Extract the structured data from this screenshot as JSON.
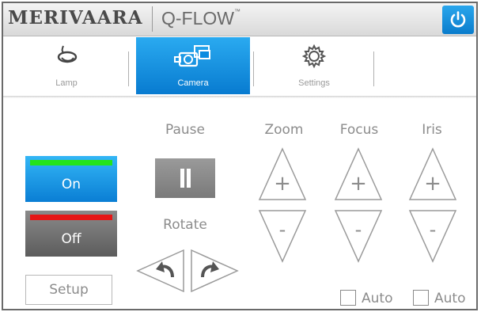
{
  "header": {
    "brand": "MERIVAARA",
    "product": "Q-FLOW",
    "trademark": "™",
    "power_icon": "power-icon",
    "accent": "#0a8ee0"
  },
  "tabs": [
    {
      "label": "Lamp",
      "icon": "lamp-icon",
      "active": false
    },
    {
      "label": "Camera",
      "icon": "camera-icon",
      "active": true
    },
    {
      "label": "Settings",
      "icon": "gear-icon",
      "active": false
    }
  ],
  "camera_panel": {
    "power": {
      "on_label": "On",
      "off_label": "Off",
      "on_indicator": "#24e31c",
      "off_indicator": "#e61616"
    },
    "setup_label": "Setup",
    "pause": {
      "label": "Pause",
      "icon": "pause-icon"
    },
    "rotate": {
      "label": "Rotate",
      "left_icon": "rotate-left-icon",
      "right_icon": "rotate-right-icon"
    },
    "zoom": {
      "label": "Zoom",
      "plus": "+",
      "minus": "-"
    },
    "focus": {
      "label": "Focus",
      "plus": "+",
      "minus": "-",
      "auto_label": "Auto",
      "auto_checked": false
    },
    "iris": {
      "label": "Iris",
      "plus": "+",
      "minus": "-",
      "auto_label": "Auto",
      "auto_checked": false
    }
  }
}
